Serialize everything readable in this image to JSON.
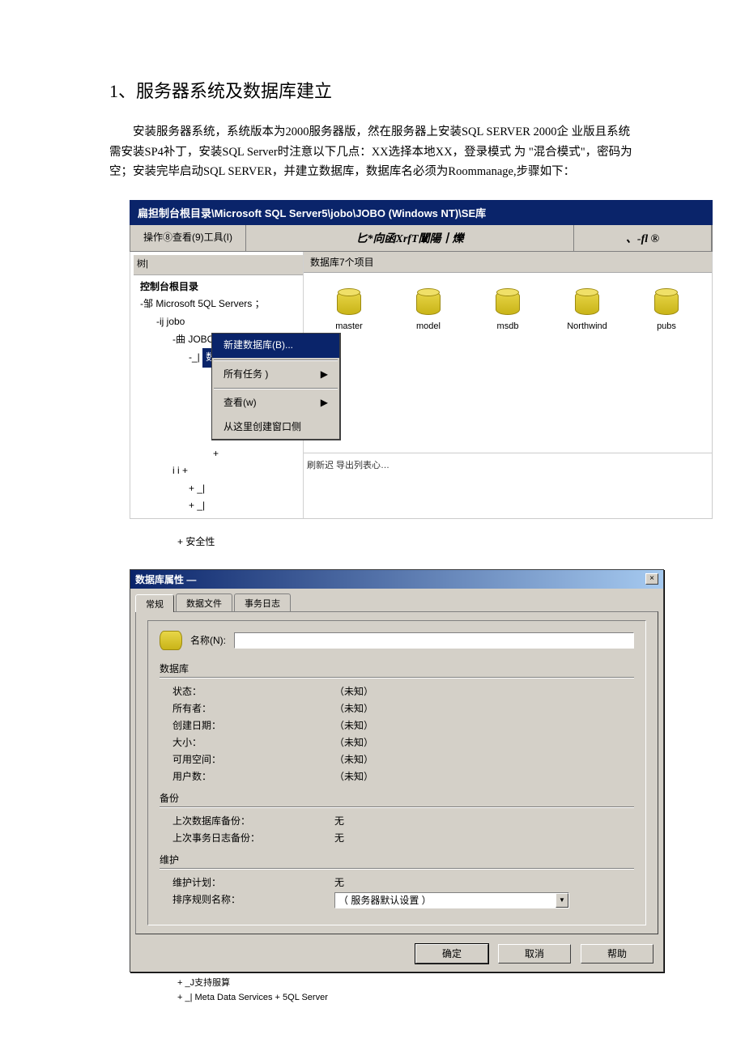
{
  "heading": "1、服务器系统及数据库建立",
  "paragraph": "安装服务器系统，系统版本为2000服务器版，然在服务器上安装SQL SERVER 2000企 业版且系统需安装SP4补丁，安装SQL Server时注意以下几点：XX选择本地XX，登录模式 为 \"混合模式\"，密码为空；安装完毕启动SQL SERVER，并建立数据库，数据库名必须为Roommanage,步骤如下：",
  "shot1": {
    "titlebar": "扁担制台根目录\\Microsoft SQL Server5\\jobo\\JOBO (Windows NT)\\SE库",
    "menubar": {
      "left": "操作⑧查看(9)工具(I)",
      "mid": "匕*向函XrfT闡陽丨爍",
      "right": "、-fl ®"
    },
    "tree": {
      "header": "树|",
      "root": "控制台根目录",
      "n1": "-邹  Microsoft 5QL Servers      ；",
      "n2": "-ij jobo",
      "n3": "-曲  JOBO (Windows NT)  ,",
      "sel": "数据库",
      "n4": "-_|",
      "plus_rows": [
        "+",
        "i          i +",
        "+ _|",
        "+ _|"
      ]
    },
    "contextmenu": {
      "i0": "新建数据库(B)...",
      "i1": "所有任务     )",
      "i2": "查看(w)",
      "i3": "从这里创建窗口侧"
    },
    "list": {
      "header": "数据库7个项目",
      "dbs": [
        "master",
        "model",
        "msdb",
        "Northwind",
        "pubs"
      ],
      "bottom": "刷新迟  导出列表心…"
    }
  },
  "below1": "+  安全性",
  "shot2": {
    "title": "数据库属性 —",
    "close": "×",
    "tabs": {
      "t0": "常规",
      "t1": "数据文件",
      "t2": "事务日志"
    },
    "name_label": "名称(N):",
    "sections": {
      "db": "数据库",
      "backup": "备份",
      "maint": "维护"
    },
    "rows": {
      "status": {
        "k": "状态：",
        "v": "（未知）"
      },
      "owner": {
        "k": "所有者：",
        "v": "（未知）"
      },
      "created": {
        "k": "创建日期：",
        "v": "（未知）"
      },
      "size": {
        "k": "大小：",
        "v": "（未知）"
      },
      "avail": {
        "k": "可用空间：",
        "v": "（未知）"
      },
      "users": {
        "k": "用户数：",
        "v": "（未知）"
      },
      "lastdb": {
        "k": "上次数据库备份：",
        "v": "无"
      },
      "lastlog": {
        "k": "上次事务日志备份：",
        "v": "无"
      },
      "plan": {
        "k": "维护计划：",
        "v": "无"
      },
      "collate": {
        "k": "排序规则名称：",
        "v": "（ 服务器默认设置 ）"
      }
    },
    "buttons": {
      "ok": "确定",
      "cancel": "取消",
      "help": "帮助"
    }
  },
  "below2": {
    "l1": "+ _J支持服算",
    "l2": "+ _| Meta Data Services + 5QL Server"
  }
}
